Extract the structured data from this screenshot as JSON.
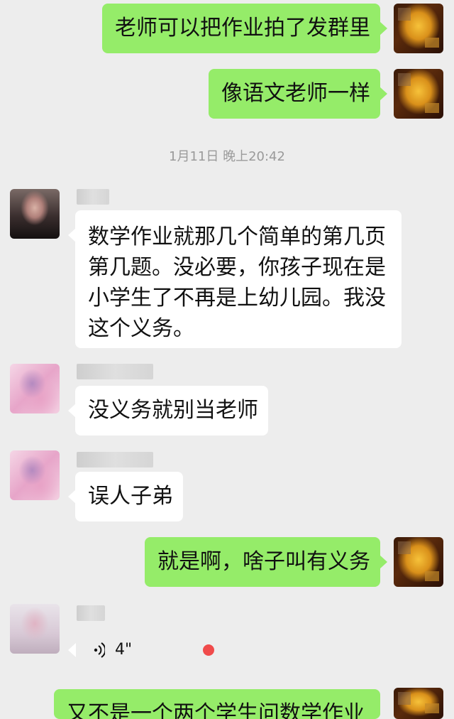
{
  "chat": {
    "timestamp": "1月11日 晚上20:42",
    "messages": [
      {
        "text": "老师可以把作业拍了发群里"
      },
      {
        "text": "像语文老师一样"
      },
      {
        "text": "数学作业就那几个简单的第几页第几题。没必要，你孩子现在是小学生了不再是上幼儿园。我没这个义务。"
      },
      {
        "text": "没义务就别当老师"
      },
      {
        "text": "误人子弟"
      },
      {
        "text": "就是啊，啥子叫有义务"
      },
      {
        "voice_duration": "4\""
      },
      {
        "text": "又不是一个两个学生问数学作业"
      }
    ]
  },
  "colors": {
    "background": "#ededed",
    "sent_bubble": "#95ec69",
    "received_bubble": "#ffffff",
    "unread_dot": "#f04b4b",
    "timestamp": "#9a9a9a"
  },
  "icons": {
    "voice": "voice-wave-icon"
  }
}
